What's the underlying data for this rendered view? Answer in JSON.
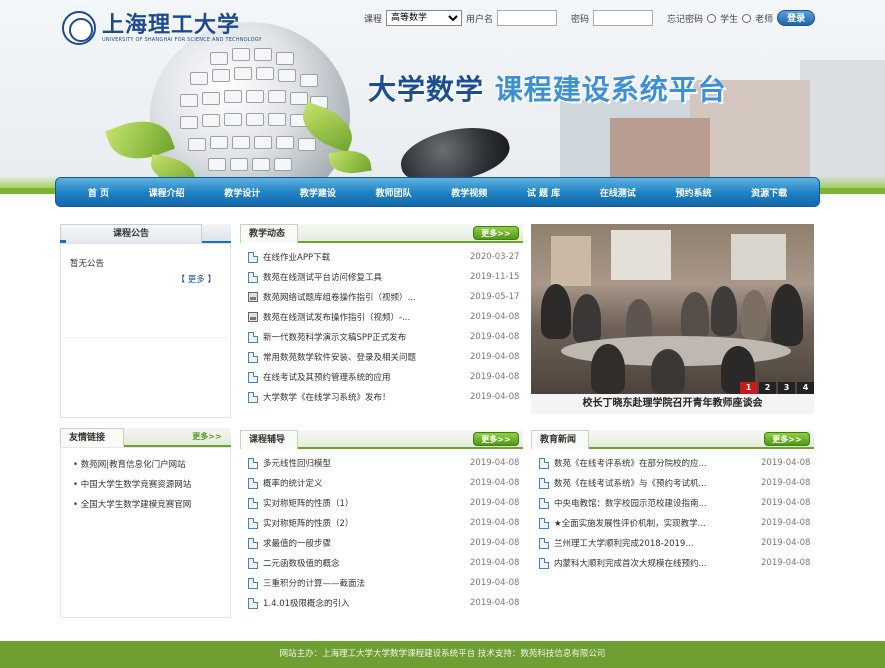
{
  "header": {
    "school_name_cn": "上海理工大学",
    "school_name_en": "UNIVERSITY OF SHANGHAI FOR SCIENCE AND TECHNOLOGY",
    "site_title_part1": "大学数学",
    "site_title_part2": " 课程建设系统平台"
  },
  "login": {
    "course_label": "课程",
    "course_selected": "高等数学",
    "username_label": "用户名",
    "password_label": "密码",
    "forgot_label": "忘记密码",
    "role_student": "学生",
    "role_teacher": "老师",
    "login_button": "登录"
  },
  "nav": {
    "items": [
      "首 页",
      "课程介绍",
      "教学设计",
      "教学建设",
      "教师团队",
      "教学视频",
      "试 题 库",
      "在线测试",
      "预约系统",
      "资源下载"
    ]
  },
  "announcement": {
    "title": "课程公告",
    "empty_text": "暂无公告",
    "more": "【 更多 】"
  },
  "teaching_news": {
    "title": "教学动态",
    "more": "更多>>",
    "items": [
      {
        "title": "在线作业APP下载",
        "date": "2020-03-27",
        "icon": "doc-icon"
      },
      {
        "title": "数苑在线测试平台访问修复工具",
        "date": "2019-11-15",
        "icon": "doc-icon"
      },
      {
        "title": "数苑网络试题库组卷操作指引（视频）...",
        "date": "2019-05-17",
        "icon": "video-icon"
      },
      {
        "title": "数苑在线测试发布操作指引（视频）-...",
        "date": "2019-04-08",
        "icon": "video-icon"
      },
      {
        "title": "新一代数苑科学演示文稿SPP正式发布",
        "date": "2019-04-08",
        "icon": "doc-icon"
      },
      {
        "title": "常用数苑数学软件安装、登录及相关问题",
        "date": "2019-04-08",
        "icon": "doc-icon"
      },
      {
        "title": "在线考试及其预约管理系统的应用",
        "date": "2019-04-08",
        "icon": "doc-icon"
      },
      {
        "title": "大学数学《在线学习系统》发布！",
        "date": "2019-04-08",
        "icon": "doc-icon"
      }
    ]
  },
  "photo": {
    "caption": "校长丁晓东赴理学院召开青年教师座谈会",
    "pages": [
      "1",
      "2",
      "3",
      "4"
    ],
    "active_page": "1"
  },
  "friend_links": {
    "title": "友情链接",
    "more": "更多>>",
    "items": [
      "• 数苑网|教育信息化门户网站",
      "• 中国大学生数学竞赛资源网站",
      "• 全国大学生数学建模竞赛官网"
    ]
  },
  "course_help": {
    "title": "课程辅导",
    "more": "更多>>",
    "items": [
      {
        "title": "多元线性回归模型",
        "date": "2019-04-08"
      },
      {
        "title": "概率的统计定义",
        "date": "2019-04-08"
      },
      {
        "title": "实对称矩阵的性质（1）",
        "date": "2019-04-08"
      },
      {
        "title": "实对称矩阵的性质（2）",
        "date": "2019-04-08"
      },
      {
        "title": "求最值的一般步骤",
        "date": "2019-04-08"
      },
      {
        "title": "二元函数极值的概念",
        "date": "2019-04-08"
      },
      {
        "title": "三重积分的计算——截面法",
        "date": "2019-04-08"
      },
      {
        "title": "1.4.01极限概念的引入",
        "date": "2019-04-08"
      }
    ]
  },
  "edu_news": {
    "title": "教育新闻",
    "more": "更多>>",
    "items": [
      {
        "title": "数苑《在线考评系统》在部分院校的应...",
        "date": "2019-04-08"
      },
      {
        "title": "数苑《在线考试系统》与《预约考试机...",
        "date": "2019-04-08"
      },
      {
        "title": "中央电教馆：数字校园示范校建设指南...",
        "date": "2019-04-08"
      },
      {
        "title": "★全面实施发展性评价机制，实现教学...",
        "date": "2019-04-08"
      },
      {
        "title": "兰州理工大学顺利完成2018-2019…",
        "date": "2019-04-08"
      },
      {
        "title": "内蒙科大顺利完成首次大规模在线预约...",
        "date": "2019-04-08"
      }
    ]
  },
  "footer": {
    "text": "网站主办：上海理工大学大学数学课程建设系统平台    技术支持：数苑科技信息有限公司"
  },
  "colors": {
    "nav_blue": "#1d7fc2",
    "accent_green": "#6aa52a",
    "footer_green": "#6f9e32",
    "title_blue": "#1c4f92"
  }
}
